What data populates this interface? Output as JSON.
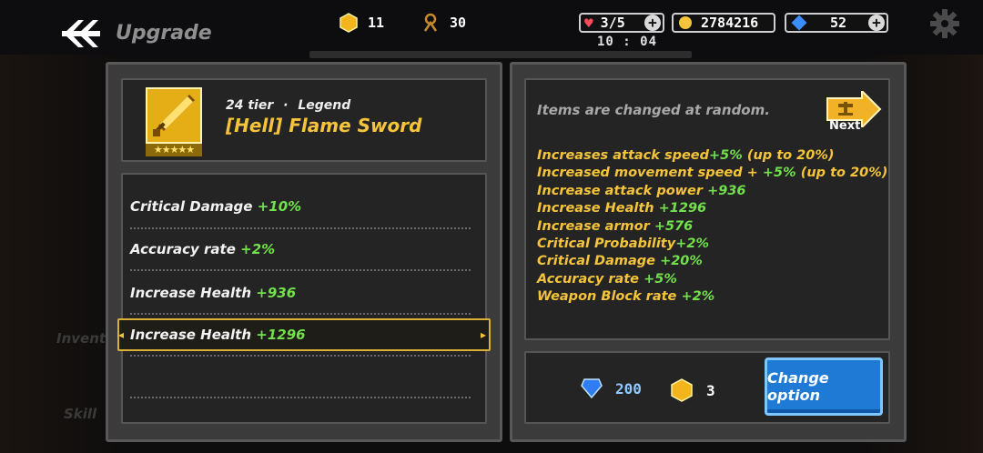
{
  "header": {
    "title": "Upgrade",
    "resource_1": "11",
    "resource_2": "30",
    "hearts": "3/5",
    "gold": "2784216",
    "gems": "52",
    "timer": "10 : 04"
  },
  "item": {
    "tier": "24 tier",
    "rarity": "Legend",
    "name": "[Hell] Flame Sword",
    "stars": "★★★★★"
  },
  "current_options": [
    {
      "label": "Critical Damage",
      "value": "+10%"
    },
    {
      "label": "Accuracy rate",
      "value": "+2%"
    },
    {
      "label": "Increase Health",
      "value": "+936"
    },
    {
      "label": "Increase Health",
      "value": "+1296"
    }
  ],
  "random_panel": {
    "note": "Items are changed at random.",
    "next_label": "Next",
    "options": [
      {
        "label": "Increases attack speed",
        "value": "+5%",
        "suffix": " (up to 20%)"
      },
      {
        "label": "Increased movement speed + ",
        "value": "+5%",
        "suffix": " (up to 20%)"
      },
      {
        "label": "Increase attack power",
        "value": "+936",
        "suffix": ""
      },
      {
        "label": "Increase Health",
        "value": "+1296",
        "suffix": ""
      },
      {
        "label": "Increase armor",
        "value": "+576",
        "suffix": ""
      },
      {
        "label": "Critical Probability",
        "value": "+2%",
        "suffix": ""
      },
      {
        "label": "Critical Damage",
        "value": "+20%",
        "suffix": ""
      },
      {
        "label": "Accuracy rate",
        "value": "+5%",
        "suffix": ""
      },
      {
        "label": "Weapon Block rate",
        "value": "+2%",
        "suffix": ""
      }
    ]
  },
  "cost": {
    "gems": "200",
    "coins": "3",
    "button": "Change option"
  },
  "background": {
    "inventory": "Invent",
    "skill": "Skill"
  },
  "colors": {
    "accent_yellow": "#f5c43a",
    "value_green": "#72e04b",
    "button_blue": "#1f7ad6"
  }
}
